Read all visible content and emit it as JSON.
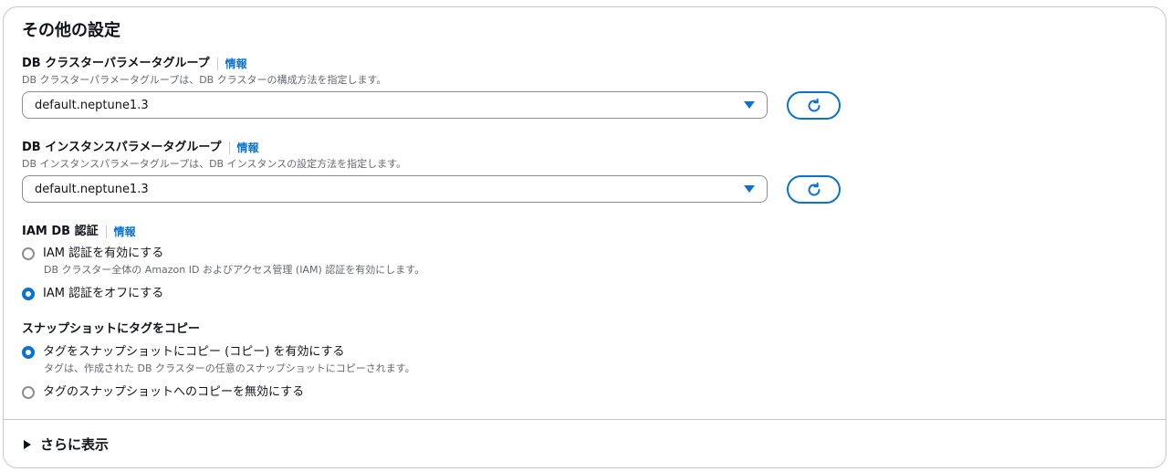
{
  "section": {
    "title": "その他の設定"
  },
  "cluster_param_group": {
    "label": "DB クラスターパラメータグループ",
    "info": "情報",
    "description": "DB クラスターパラメータグループは、DB クラスターの構成方法を指定します。",
    "selected": "default.neptune1.3",
    "refresh_icon": "refresh-icon"
  },
  "instance_param_group": {
    "label": "DB インスタンスパラメータグループ",
    "info": "情報",
    "description": "DB インスタンスパラメータグループは、DB インスタンスの設定方法を指定します。",
    "selected": "default.neptune1.3",
    "refresh_icon": "refresh-icon"
  },
  "iam_auth": {
    "label": "IAM DB 認証",
    "info": "情報",
    "options": [
      {
        "label": "IAM 認証を有効にする",
        "description": "DB クラスター全体の Amazon ID およびアクセス管理 (IAM) 認証を有効にします。",
        "checked": false
      },
      {
        "label": "IAM 認証をオフにする",
        "description": "",
        "checked": true
      }
    ]
  },
  "copy_tags": {
    "label": "スナップショットにタグをコピー",
    "options": [
      {
        "label": "タグをスナップショットにコピー (コピー) を有効にする",
        "description": "タグは、作成された DB クラスターの任意のスナップショットにコピーされます。",
        "checked": true
      },
      {
        "label": "タグのスナップショットへのコピーを無効にする",
        "description": "",
        "checked": false
      }
    ]
  },
  "show_more": {
    "label": "さらに表示"
  },
  "colors": {
    "accent": "#0972d3",
    "text": "#0f141a",
    "muted": "#656871",
    "border": "#c6c6cd"
  }
}
